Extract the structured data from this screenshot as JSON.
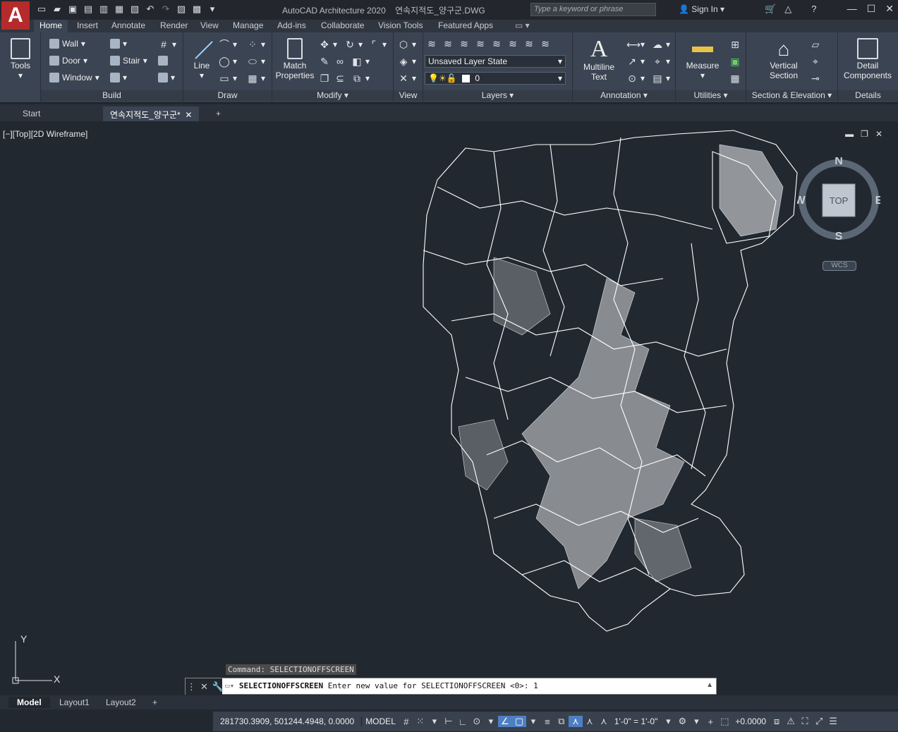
{
  "app": {
    "logo_letter": "A",
    "title": "AutoCAD Architecture 2020",
    "document": "연속지적도_양구군.DWG",
    "search_placeholder": "Type a keyword or phrase",
    "sign_in": "Sign In"
  },
  "ribbon_tabs": [
    {
      "label": "Home",
      "active": true
    },
    {
      "label": "Insert"
    },
    {
      "label": "Annotate"
    },
    {
      "label": "Render"
    },
    {
      "label": "View"
    },
    {
      "label": "Manage"
    },
    {
      "label": "Add-ins"
    },
    {
      "label": "Collaborate"
    },
    {
      "label": "Vision Tools"
    },
    {
      "label": "Featured Apps"
    }
  ],
  "panels": {
    "tools": {
      "label": "Tools"
    },
    "build": {
      "title": "Build",
      "wall": "Wall",
      "door": "Door",
      "window": "Window",
      "stair": "Stair"
    },
    "draw": {
      "title": "Draw",
      "line": "Line"
    },
    "modify": {
      "title": "Modify",
      "match1": "Match",
      "match2": "Properties"
    },
    "view": {
      "title": "View"
    },
    "layers": {
      "title": "Layers",
      "layer_state": "Unsaved Layer State",
      "current_layer": "0"
    },
    "annotation": {
      "title": "Annotation",
      "mtext1": "Multiline",
      "mtext2": "Text"
    },
    "utilities": {
      "title": "Utilities",
      "measure": "Measure"
    },
    "section": {
      "title": "Section & Elevation",
      "vs1": "Vertical",
      "vs2": "Section"
    },
    "details": {
      "title": "Details",
      "dc1": "Detail",
      "dc2": "Components"
    }
  },
  "doc_tabs": {
    "start": "Start",
    "active": "연속지적도_양구군*"
  },
  "viewport": {
    "label": "[−][Top][2D Wireframe]",
    "viewcube": {
      "top": "TOP",
      "n": "N",
      "s": "S",
      "e": "E",
      "w": "W",
      "wcs": "WCS"
    },
    "ucs": {
      "x": "X",
      "y": "Y"
    }
  },
  "command": {
    "history": "Command: SELECTIONOFFSCREEN",
    "prompt_cmd": "SELECTIONOFFSCREEN",
    "prompt_rest": " Enter new value for SELECTIONOFFSCREEN <0>: 1"
  },
  "layout_tabs": [
    "Model",
    "Layout1",
    "Layout2"
  ],
  "status": {
    "coords": "281730.3909, 501244.4948, 0.0000",
    "model": "MODEL",
    "scale": "1'-0\" = 1'-0\"",
    "elevation": "+0.0000"
  }
}
